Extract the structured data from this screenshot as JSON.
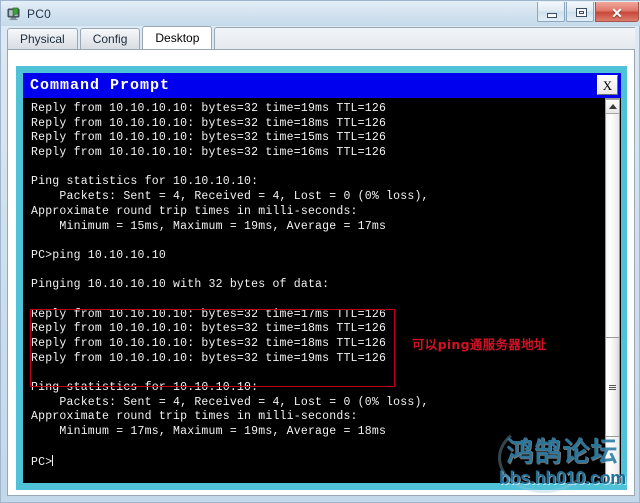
{
  "window": {
    "title": "PC0",
    "icon": "pc-device-icon",
    "buttons": {
      "minimize": "minimize-icon",
      "maximize": "maximize-icon",
      "close_label": "✕"
    }
  },
  "tabs": [
    {
      "label": "Physical",
      "active": false
    },
    {
      "label": "Config",
      "active": false
    },
    {
      "label": "Desktop",
      "active": true
    }
  ],
  "command_prompt": {
    "title": "Command Prompt",
    "close_label": "X",
    "lines": [
      "Reply from 10.10.10.10: bytes=32 time=19ms TTL=126",
      "Reply from 10.10.10.10: bytes=32 time=18ms TTL=126",
      "Reply from 10.10.10.10: bytes=32 time=15ms TTL=126",
      "Reply from 10.10.10.10: bytes=32 time=16ms TTL=126",
      "",
      "Ping statistics for 10.10.10.10:",
      "    Packets: Sent = 4, Received = 4, Lost = 0 (0% loss),",
      "Approximate round trip times in milli-seconds:",
      "    Minimum = 15ms, Maximum = 19ms, Average = 17ms",
      "",
      "PC>ping 10.10.10.10",
      "",
      "Pinging 10.10.10.10 with 32 bytes of data:",
      "",
      "Reply from 10.10.10.10: bytes=32 time=17ms TTL=126",
      "Reply from 10.10.10.10: bytes=32 time=18ms TTL=126",
      "Reply from 10.10.10.10: bytes=32 time=18ms TTL=126",
      "Reply from 10.10.10.10: bytes=32 time=19ms TTL=126",
      "",
      "Ping statistics for 10.10.10.10:",
      "    Packets: Sent = 4, Received = 4, Lost = 0 (0% loss),",
      "Approximate round trip times in milli-seconds:",
      "    Minimum = 17ms, Maximum = 19ms, Average = 18ms",
      "",
      "PC>"
    ],
    "annotation": {
      "text": "可以ping通服务器地址",
      "color": "#d21222"
    },
    "scrollbar": {
      "up_arrow": "scroll-up-arrow-icon",
      "thumb": "scrollbar-thumb"
    }
  },
  "watermark": {
    "brand": "鸿鹄论坛",
    "url": "bbs.hh010.com"
  },
  "colors": {
    "cyan_shell": "#4fc2d8",
    "cmd_titlebar": "#0000ee",
    "terminal_bg": "#000000",
    "terminal_fg": "#f2f2f2",
    "annotation_red": "#d21222",
    "box_red": "#c00018"
  }
}
